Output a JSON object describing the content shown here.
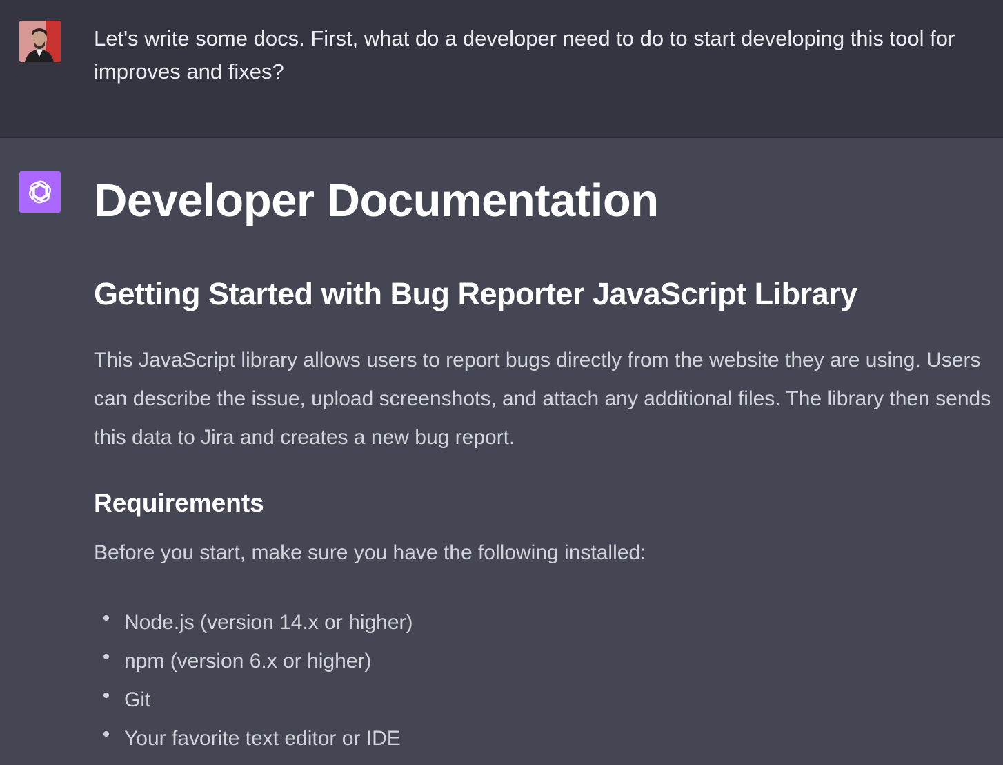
{
  "user_message": {
    "avatar_icon": "user-avatar-photo",
    "text": "Let's write some docs. First, what do a developer need to do to start developing this tool for improves and fixes?"
  },
  "assistant_message": {
    "avatar_icon": "openai-logo-icon",
    "avatar_color": "#ab68ff",
    "title": "Developer Documentation",
    "subtitle": "Getting Started with Bug Reporter JavaScript Library",
    "intro": "This JavaScript library allows users to report bugs directly from the website they are using. Users can describe the issue, upload screenshots, and attach any additional files. The library then sends this data to Jira and creates a new bug report.",
    "requirements": {
      "heading": "Requirements",
      "intro": "Before you start, make sure you have the following installed:",
      "items": [
        "Node.js (version 14.x or higher)",
        "npm (version 6.x or higher)",
        "Git",
        "Your favorite text editor or IDE"
      ]
    }
  },
  "colors": {
    "user_bg": "#343541",
    "assistant_bg": "#444654",
    "heading_text": "#ffffff",
    "body_text": "#d1d5db"
  }
}
